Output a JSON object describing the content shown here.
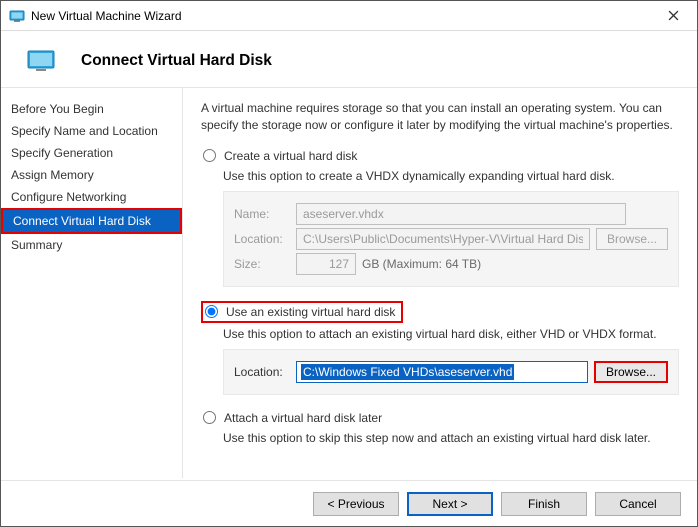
{
  "window": {
    "title": "New Virtual Machine Wizard"
  },
  "header": {
    "title": "Connect Virtual Hard Disk"
  },
  "sidebar": {
    "steps": [
      "Before You Begin",
      "Specify Name and Location",
      "Specify Generation",
      "Assign Memory",
      "Configure Networking",
      "Connect Virtual Hard Disk",
      "Summary"
    ],
    "active_index": 5
  },
  "main": {
    "intro": "A virtual machine requires storage so that you can install an operating system. You can specify the storage now or configure it later by modifying the virtual machine's properties.",
    "option_create": {
      "label": "Create a virtual hard disk",
      "desc": "Use this option to create a VHDX dynamically expanding virtual hard disk.",
      "name_label": "Name:",
      "name_value": "aseserver.vhdx",
      "location_label": "Location:",
      "location_value": "C:\\Users\\Public\\Documents\\Hyper-V\\Virtual Hard Disks\\",
      "browse_label": "Browse...",
      "size_label": "Size:",
      "size_value": "127",
      "size_unit": "GB (Maximum: 64 TB)"
    },
    "option_existing": {
      "label": "Use an existing virtual hard disk",
      "desc": "Use this option to attach an existing virtual hard disk, either VHD or VHDX format.",
      "location_label": "Location:",
      "location_value": "C:\\Windows Fixed VHDs\\aseserver.vhd",
      "browse_label": "Browse..."
    },
    "option_later": {
      "label": "Attach a virtual hard disk later",
      "desc": "Use this option to skip this step now and attach an existing virtual hard disk later."
    }
  },
  "footer": {
    "previous": "< Previous",
    "next": "Next >",
    "finish": "Finish",
    "cancel": "Cancel"
  }
}
